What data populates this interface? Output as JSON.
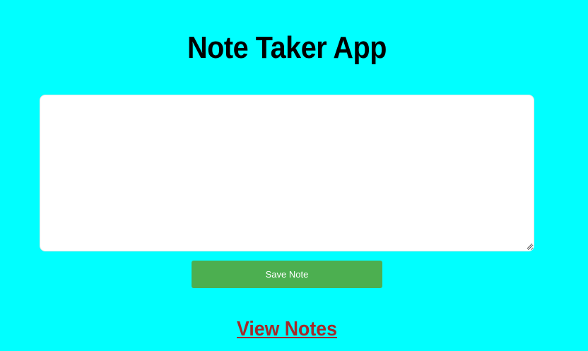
{
  "header": {
    "title": "Note Taker App"
  },
  "note_editor": {
    "value": "",
    "placeholder": ""
  },
  "actions": {
    "save_label": "Save Note",
    "view_notes_label": "View Notes"
  },
  "colors": {
    "background": "#00ffff",
    "save_button": "#4caf50",
    "link": "#a52a2a",
    "title": "#000000"
  }
}
